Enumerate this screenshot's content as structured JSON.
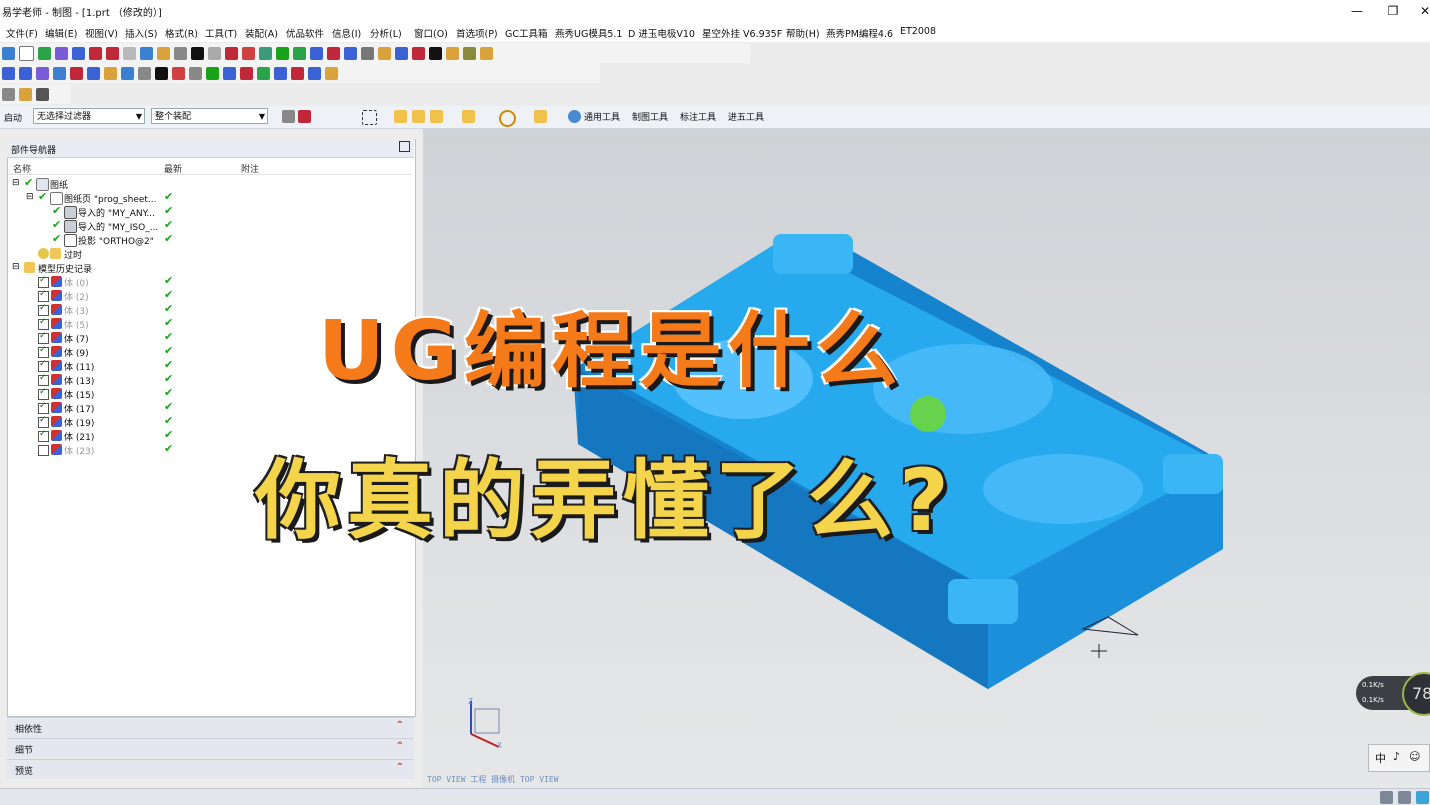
{
  "window": {
    "title": "易学老师 - 制图 - [1.prt （修改的）]",
    "minimize_glyph": "—",
    "restore_glyph": "❐",
    "close_glyph": "✕"
  },
  "menu": [
    "文件(F)",
    "编辑(E)",
    "视图(V)",
    "插入(S)",
    "格式(R)",
    "工具(T)",
    "装配(A)",
    "优品软件",
    "信息(I)",
    "分析(L)",
    "窗口(O)",
    "首选项(P)",
    "GC工具箱",
    "燕秀UG模具5.1",
    "D 进玉电极V10",
    "星空外挂 V6.935F",
    "帮助(H)",
    "燕秀PM编程4.6",
    "ET2008"
  ],
  "filterbar": {
    "start_label": "启动",
    "filter_value": "无选择过滤器",
    "assembly_value": "整个装配",
    "tool_groups": [
      "通用工具",
      "制图工具",
      "标注工具",
      "进五工具"
    ]
  },
  "navigator": {
    "title": "部件导航器",
    "columns": [
      "名称",
      "最新",
      "附注"
    ],
    "drawing_root": "图纸",
    "sheet": "图纸页 \"prog_sheet...",
    "sheet_children": [
      "导入的 \"MY_ANY...",
      "导入的 \"MY_ISO_...",
      "投影 \"ORTHO@2\""
    ],
    "outdated": "过时",
    "history": "模型历史记录",
    "bodies": [
      {
        "label": "体 (0)",
        "grey": true,
        "on": true,
        "latest": true
      },
      {
        "label": "体 (2)",
        "grey": true,
        "on": true,
        "latest": true
      },
      {
        "label": "体 (3)",
        "grey": true,
        "on": true,
        "latest": true
      },
      {
        "label": "体 (5)",
        "grey": true,
        "on": true,
        "latest": true
      },
      {
        "label": "体 (7)",
        "grey": false,
        "on": true,
        "latest": true
      },
      {
        "label": "体 (9)",
        "grey": false,
        "on": true,
        "latest": true
      },
      {
        "label": "体 (11)",
        "grey": false,
        "on": true,
        "latest": true
      },
      {
        "label": "体 (13)",
        "grey": false,
        "on": true,
        "latest": true
      },
      {
        "label": "体 (15)",
        "grey": false,
        "on": true,
        "latest": true
      },
      {
        "label": "体 (17)",
        "grey": false,
        "on": true,
        "latest": true
      },
      {
        "label": "体 (19)",
        "grey": false,
        "on": true,
        "latest": true
      },
      {
        "label": "体 (21)",
        "grey": false,
        "on": true,
        "latest": true
      },
      {
        "label": "体 (23)",
        "grey": true,
        "on": false,
        "latest": true
      }
    ],
    "panels": [
      "相依性",
      "细节",
      "预览"
    ]
  },
  "overlay": {
    "line1": "UG编程是什么",
    "line2": "你真的弄懂了么?"
  },
  "viewport": {
    "view_label": "TOP VIEW  工程 摄像机  TOP VIEW",
    "axis_x": "X",
    "axis_z": "Z",
    "model_color": "#1f9fe8"
  },
  "speed": {
    "up": "0.1K/s",
    "down": "0.1K/s",
    "percent": "78"
  },
  "ime": [
    "中",
    "♪",
    "☺"
  ]
}
